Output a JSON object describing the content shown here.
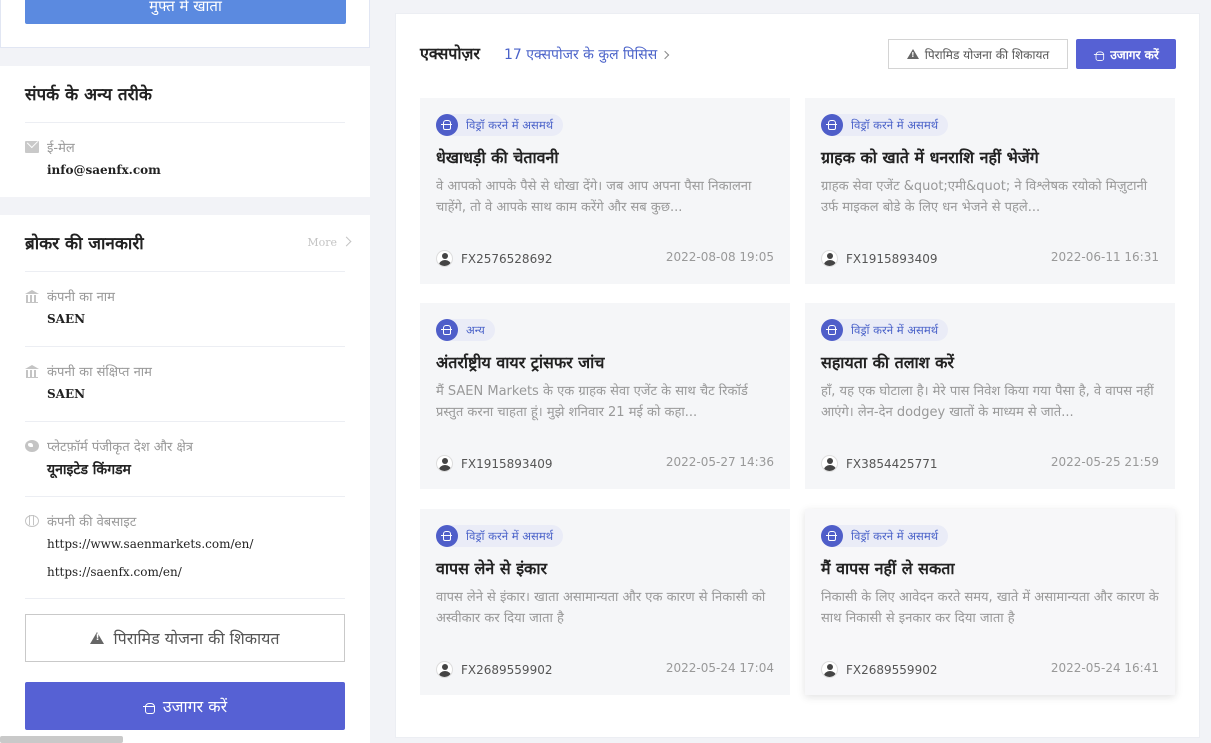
{
  "left": {
    "top_button_label": "मुफ्त में खाता",
    "contact": {
      "title": "संपर्क के अन्य तरीके",
      "email_label": "ई-मेल",
      "email_value": "info@saenfx.com"
    },
    "broker": {
      "title": "ब्रोकर की जानकारी",
      "more": "More",
      "company_name_label": "कंपनी का नाम",
      "company_name_value": "SAEN",
      "short_name_label": "कंपनी का संक्षिप्त नाम",
      "short_name_value": "SAEN",
      "region_label": "प्लेटफ़ॉर्म पंजीकृत देश और क्षेत्र",
      "region_value": "यूनाइटेड किंगडम",
      "website_label": "कंपनी की वेबसाइट",
      "website_1": "https://www.saenmarkets.com/en/",
      "website_2": "https://saenfx.com/en/"
    },
    "pyramid_button": "पिरामिड योजना की शिकायत",
    "expose_button": "उजागर करें"
  },
  "panel": {
    "title": "एक्सपोज़र",
    "total_link": "17 एक्सपोजर के कुल पिसिस",
    "pyramid_button": "पिरामिड योजना की शिकायत",
    "expose_button": "उजागर करें",
    "cards": [
      {
        "tag": "विड्रॉ करने में असमर्थ",
        "title": "धेखाधड़ी की चेतावनी",
        "desc": "वे आपको आपके पैसे से धोखा देंगे। जब आप अपना पैसा निकालना चाहेंगे, तो वे आपके साथ काम करेंगे और सब कुछ...",
        "user": "FX2576528692",
        "date": "2022-08-08 19:05"
      },
      {
        "tag": "विड्रॉ करने में असमर्थ",
        "title": "ग्राहक को खाते में धनराशि नहीं भेजेंगे",
        "desc": "ग्राहक सेवा एजेंट &quot;एमी&quot; ने विश्लेषक रयोको मिज़ुटानी उर्फ माइकल बोडे के लिए धन भेजने से पहले...",
        "user": "FX1915893409",
        "date": "2022-06-11 16:31"
      },
      {
        "tag": "अन्य",
        "title": "अंतर्राष्ट्रीय वायर ट्रांसफर जांच",
        "desc": "मैं SAEN Markets के एक ग्राहक सेवा एजेंट के साथ चैट रिकॉर्ड प्रस्तुत करना चाहता हूं। मुझे शनिवार 21 मई को कहा...",
        "user": "FX1915893409",
        "date": "2022-05-27 14:36"
      },
      {
        "tag": "विड्रॉ करने में असमर्थ",
        "title": "सहायता की तलाश करें",
        "desc": "हाँ, यह एक घोटाला है। मेरे पास निवेश किया गया पैसा है, वे वापस नहीं आएंगे। लेन-देन dodgey खातों के माध्यम से जाते...",
        "user": "FX3854425771",
        "date": "2022-05-25 21:59"
      },
      {
        "tag": "विड्रॉ करने में असमर्थ",
        "title": "वापस लेने से इंकार",
        "desc": "वापस लेने से इंकार। खाता असामान्यता और एक कारण से निकासी को अस्वीकार कर दिया जाता है",
        "user": "FX2689559902",
        "date": "2022-05-24 17:04"
      },
      {
        "tag": "विड्रॉ करने में असमर्थ",
        "title": "मैं वापस नहीं ले सकता",
        "desc": "निकासी के लिए आवेदन करते समय, खाते में असामान्यता और कारण के साथ निकासी से इनकार कर दिया जाता है",
        "user": "FX2689559902",
        "date": "2022-05-24 16:41"
      }
    ]
  }
}
